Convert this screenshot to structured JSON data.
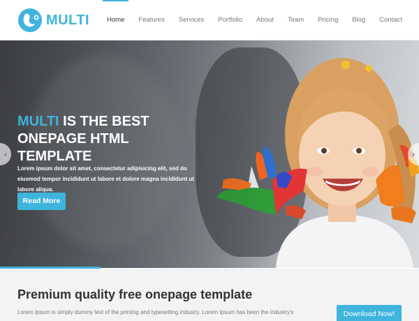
{
  "brand": {
    "name": "MULTI",
    "icon": "multi-logo-icon",
    "color": "#3fb4dd"
  },
  "nav": {
    "items": [
      {
        "label": "Home",
        "active": true
      },
      {
        "label": "Features",
        "active": false
      },
      {
        "label": "Services",
        "active": false
      },
      {
        "label": "Portfolio",
        "active": false
      },
      {
        "label": "About",
        "active": false
      },
      {
        "label": "Team",
        "active": false
      },
      {
        "label": "Pricing",
        "active": false
      },
      {
        "label": "Blog",
        "active": false
      },
      {
        "label": "Contact",
        "active": false
      }
    ]
  },
  "hero": {
    "title_accent": "MULTI",
    "title_rest": " IS THE BEST ONEPAGE HTML TEMPLATE",
    "text": "Lorem ipsum dolor sit amet, consectetur adipisicing elit, sed do eiusmod tempor incididunt ut labore et dolore magna incididunt ut labore aliqua.",
    "button_label": "Read More",
    "prev_icon": "chevron-left-icon",
    "next_icon": "chevron-right-icon",
    "slide_progress": 0.24
  },
  "promo": {
    "title": "Premium quality free onepage template",
    "text": "Lorem Ipsum is simply dummy text of the printing and typesetting industry. Lorem Ipsum has been the industry's",
    "button_label": "Download Now!"
  }
}
